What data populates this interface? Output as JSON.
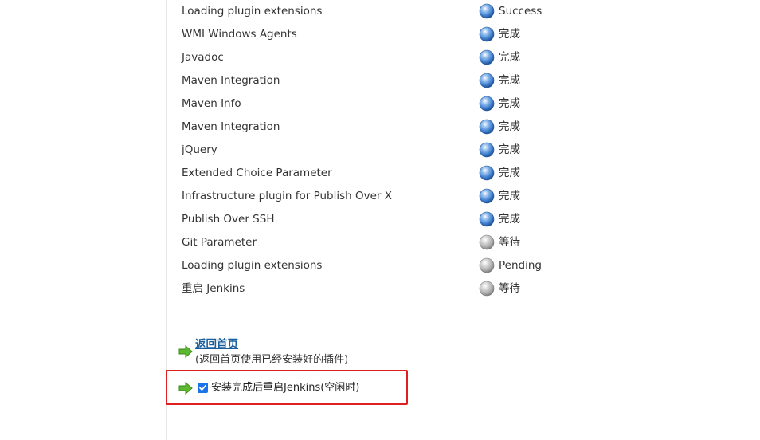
{
  "plugins": [
    {
      "name": "Loading plugin extensions",
      "status": "Success",
      "state": "done"
    },
    {
      "name": "WMI Windows Agents",
      "status": "完成",
      "state": "done"
    },
    {
      "name": "Javadoc",
      "status": "完成",
      "state": "done"
    },
    {
      "name": "Maven Integration",
      "status": "完成",
      "state": "done"
    },
    {
      "name": "Maven Info",
      "status": "完成",
      "state": "done"
    },
    {
      "name": "Maven Integration",
      "status": "完成",
      "state": "done"
    },
    {
      "name": "jQuery",
      "status": "完成",
      "state": "done"
    },
    {
      "name": "Extended Choice Parameter",
      "status": "完成",
      "state": "done"
    },
    {
      "name": "Infrastructure plugin for Publish Over X",
      "status": "完成",
      "state": "done"
    },
    {
      "name": "Publish Over SSH",
      "status": "完成",
      "state": "done"
    },
    {
      "name": "Git Parameter",
      "status": "等待",
      "state": "pending"
    },
    {
      "name": "Loading plugin extensions",
      "status": "Pending",
      "state": "pending"
    },
    {
      "name": "重启 Jenkins",
      "status": "等待",
      "state": "pending"
    }
  ],
  "home": {
    "link_label": "返回首页",
    "description": "(返回首页使用已经安装好的插件)"
  },
  "restart": {
    "label": "安装完成后重启Jenkins(空闲时)",
    "checked": true
  },
  "colors": {
    "done_ball": "#3f7fcf",
    "pending_ball": "#b0b0b0",
    "link": "#1a5e9c",
    "arrow": "#5cb82e",
    "highlight": "#e02020",
    "checkbox": "#1a73e8"
  },
  "icons": {
    "done": "blue-ball-icon",
    "pending": "grey-ball-icon",
    "arrow": "green-arrow-icon",
    "check": "checkmark-icon"
  }
}
